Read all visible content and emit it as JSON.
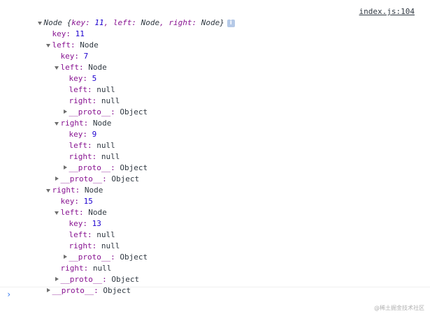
{
  "console": {
    "root_line_prefix": "Node {",
    "root_key_label": "key:",
    "root_key_value": "11",
    "root_left_label": ", left:",
    "root_left_value": "Node",
    "root_right_label": ", right:",
    "root_right_value": "Node}",
    "source_link": "index.js:104",
    "info_icon": "i"
  },
  "tree": {
    "key_label": "key",
    "left_label": "left",
    "right_label": "right",
    "proto_label": "__proto__",
    "node_type": "Node",
    "object_type": "Object",
    "null_value": "null",
    "root_key": "11",
    "left_key": "7",
    "left_left_key": "5",
    "left_right_key": "9",
    "right_key": "15",
    "right_left_key": "13"
  },
  "prompt": {
    "symbol": "›"
  },
  "watermark": "@稀土掘金技术社区"
}
